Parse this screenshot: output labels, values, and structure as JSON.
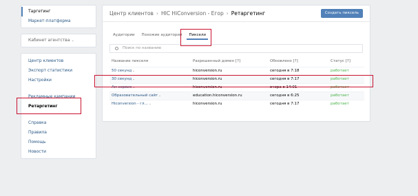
{
  "sidebar": {
    "group1": [
      {
        "label": "Таргетинг"
      },
      {
        "label": "Маркет-платформа"
      }
    ],
    "agency_label": "Кабинет агентства",
    "group2": [
      {
        "label": "Центр клиентов"
      },
      {
        "label": "Экспорт статистики"
      },
      {
        "label": "Настройки"
      }
    ],
    "group3": [
      {
        "label": "Рекламные кампании"
      },
      {
        "label": "Ретаргетинг"
      }
    ],
    "group4": [
      {
        "label": "Справка"
      },
      {
        "label": "Правила"
      },
      {
        "label": "Помощь"
      },
      {
        "label": "Новости"
      }
    ]
  },
  "header": {
    "crumb1": "Центр клиентов",
    "crumb2": "HIC HiConversion - Егор",
    "current": "Ретаргетинг",
    "create_button": "Создать пиксель"
  },
  "tabs": [
    "Аудитории",
    "Похожие аудитории",
    "Пиксели"
  ],
  "search": {
    "placeholder": "Поиск по названию"
  },
  "table": {
    "headers": [
      "Название пикселя",
      "Разрешенный домен [?]",
      "Обновлено [?]",
      "Статус [?]"
    ],
    "rows": [
      {
        "name": "50 секунд",
        "domain": "hiconversion.ru",
        "updated": "сегодня в 7:18",
        "status": "работает"
      },
      {
        "name": "30 секунд",
        "domain": "hiconversion.ru",
        "updated": "сегодня в 7:17",
        "status": "работает"
      },
      {
        "name": "Ам сервис",
        "domain": "hiconversion.ru",
        "updated": "вчера в 14:01",
        "status": "работает"
      },
      {
        "name": "Образовательный сайт",
        "domain": "education.hiconversion.ru",
        "updated": "сегодня в 6:25",
        "status": "работает"
      },
      {
        "name": "Hiconversion - гл...",
        "domain": "hiconversion.ru",
        "updated": "сегодня в 7:17",
        "status": "работает"
      }
    ]
  },
  "colors": {
    "accent": "#5181b8",
    "highlight": "#c8102e",
    "status_ok": "#4bb34b"
  },
  "icons": {
    "search": "search-icon",
    "chevron": "chevron-down-icon"
  }
}
